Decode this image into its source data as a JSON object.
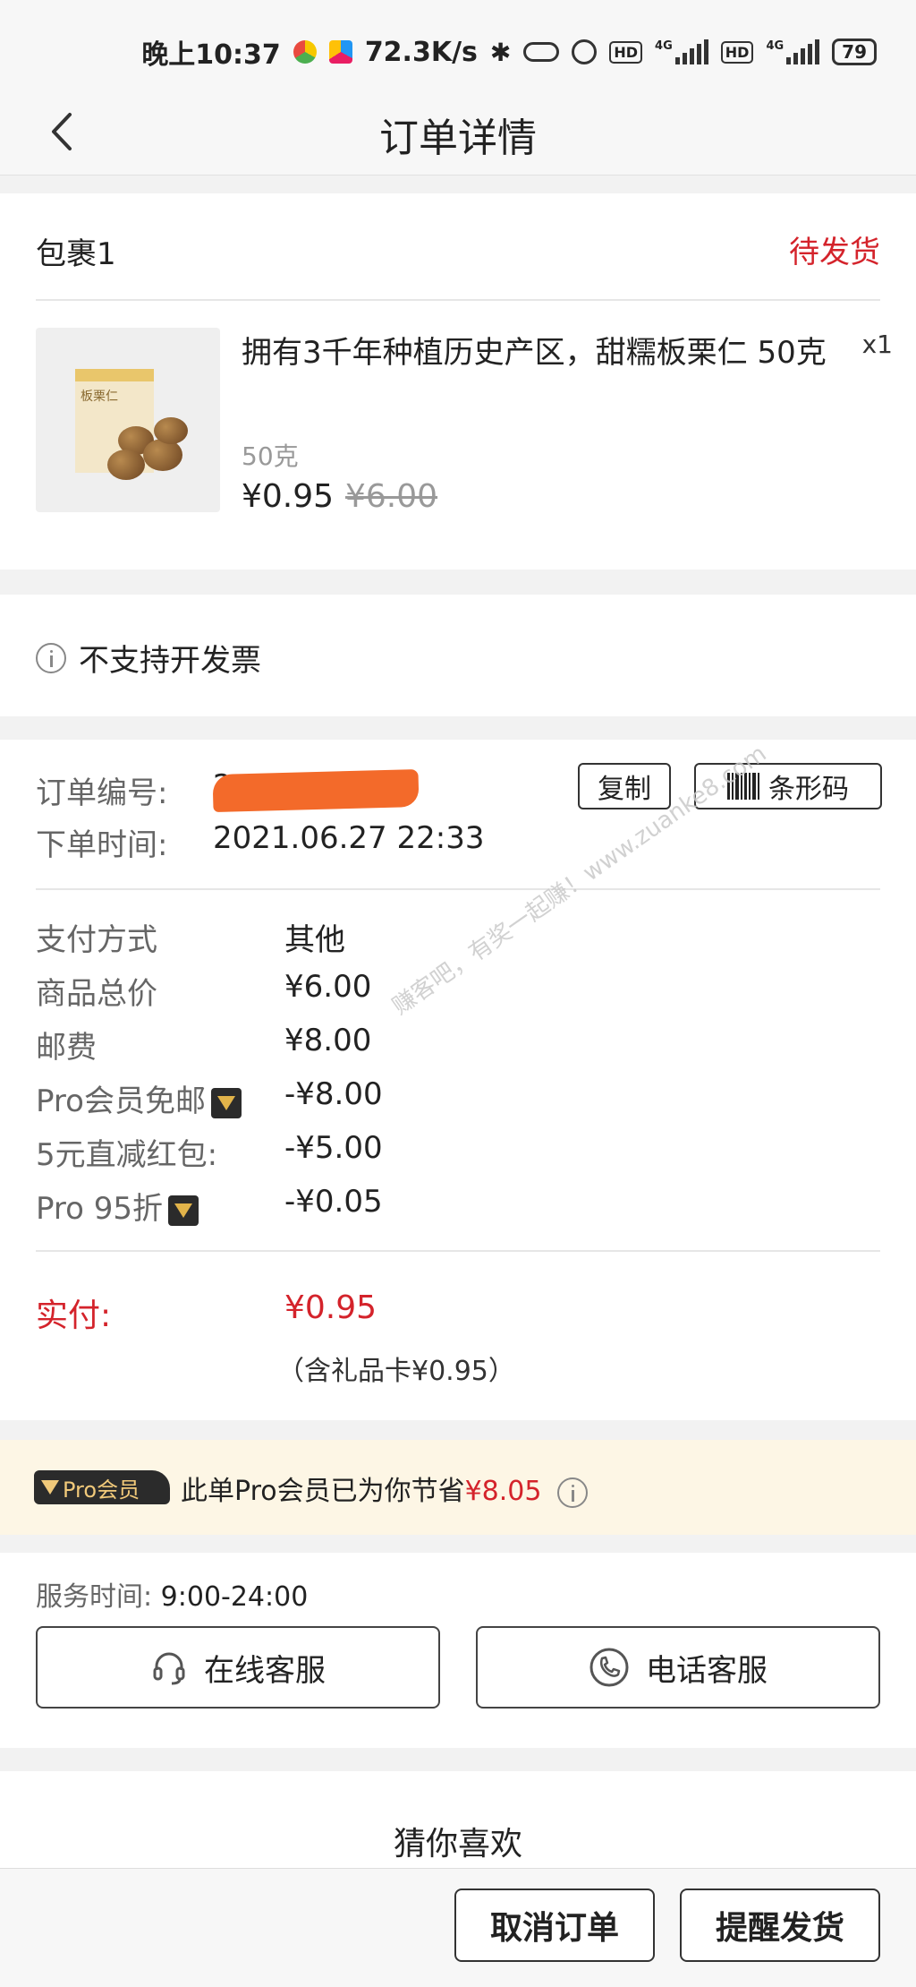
{
  "status_bar": {
    "time": "晚上10:37",
    "net_speed": "72.3K/s",
    "network_1": "4G",
    "network_2": "4G",
    "hd_label": "HD",
    "battery": "79"
  },
  "header": {
    "title": "订单详情"
  },
  "package": {
    "title": "包裹1",
    "status": "待发货",
    "product": {
      "image_label": "板栗仁",
      "name": "拥有3千年种植历史产区，甜糯板栗仁 50克",
      "quantity": "x1",
      "spec": "50克",
      "price": "¥0.95",
      "original_price": "¥6.00"
    }
  },
  "invoice": {
    "text": "不支持开发票"
  },
  "order_info": {
    "order_no_label": "订单编号:",
    "order_no_value": "2",
    "copy_button": "复制",
    "barcode_button": "条形码",
    "order_time_label": "下单时间:",
    "order_time_value": "2021.06.27 22:33"
  },
  "payment": {
    "rows": [
      {
        "label": "支付方式",
        "value": "其他"
      },
      {
        "label": "商品总价",
        "value": "¥6.00"
      },
      {
        "label": "邮费",
        "value": "¥8.00"
      },
      {
        "label": "Pro会员免邮",
        "value": "-¥8.00"
      },
      {
        "label": "5元直减红包:",
        "value": "-¥5.00"
      },
      {
        "label": "Pro 95折",
        "value": "-¥0.05"
      }
    ],
    "paid_label": "实付:",
    "paid_value": "¥0.95",
    "paid_note": "（含礼品卡¥0.95）"
  },
  "watermark": "赚客吧，有奖一起赚！www.zuanke8.com",
  "pro_banner": {
    "tag": "Pro会员",
    "text": "此单Pro会员已为你节省",
    "amount": "¥8.05"
  },
  "service": {
    "time_label": "服务时间:",
    "time_value": "9:00-24:00",
    "online_button": "在线客服",
    "phone_button": "电话客服"
  },
  "recommend": {
    "title": "猜你喜欢"
  },
  "bottom_bar": {
    "cancel_button": "取消订单",
    "remind_button": "提醒发货"
  },
  "colors": {
    "accent_red": "#d4232b",
    "pro_gold": "#f1c97a",
    "pro_dark": "#2b2b2b",
    "banner_bg": "#fdf6e5"
  },
  "icons": [
    "back-arrow-icon",
    "info-icon",
    "barcode-icon",
    "pro-badge-icon",
    "headset-icon",
    "phone-icon"
  ]
}
